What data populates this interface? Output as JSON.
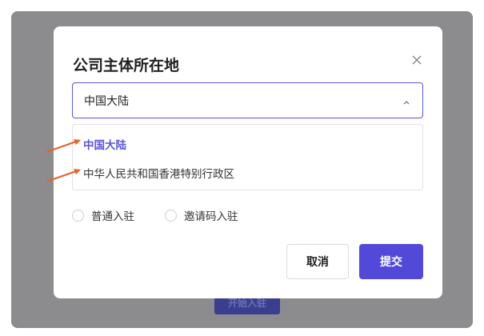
{
  "background": {
    "start_button_label": "开始入驻"
  },
  "modal": {
    "title": "公司主体所在地",
    "close_icon": "close-icon",
    "select": {
      "value": "中国大陆",
      "icon": "chevron-up-icon"
    },
    "options": [
      {
        "label": "中国大陆",
        "selected": true
      },
      {
        "label": "中华人民共和国香港特别行政区",
        "selected": false
      }
    ],
    "radios": [
      {
        "label": "普通入驻",
        "checked": false
      },
      {
        "label": "邀请码入驻",
        "checked": false
      }
    ],
    "cancel_label": "取消",
    "submit_label": "提交"
  },
  "colors": {
    "accent": "#5249d9",
    "arrow": "#e8622b",
    "overlay": "#8c8c8f"
  }
}
